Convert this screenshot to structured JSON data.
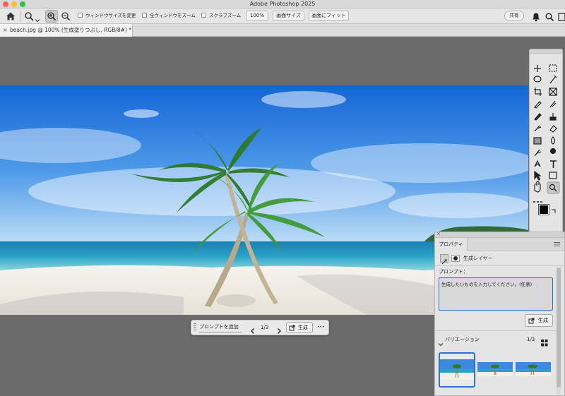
{
  "window": {
    "title": "Adobe Photoshop 2025"
  },
  "options_bar": {
    "resize_window_label": "ウィンドウサイズを変更",
    "zoom_all_windows_label": "全ウィンドウをズーム",
    "scrubby_zoom_label": "スクラブズーム",
    "zoom_value": "100%",
    "fit_screen_label": "画面サイズ",
    "fill_screen_label": "画面にフィット",
    "share_label": "共有"
  },
  "document_tab": {
    "title": "beach.jpg @ 100% (生成塗りつぶし, RGB/8#) *",
    "close_glyph": "×"
  },
  "contextual_taskbar": {
    "prompt_label": "プロンプトを追加",
    "page_indicator": "1/3",
    "generate_label": "生成",
    "more_glyph": "•••"
  },
  "properties_panel": {
    "tab_label": "プロパティ",
    "layer_type": "生成レイヤー",
    "prompt_heading": "プロンプト：",
    "prompt_placeholder": "生成したいものを入力してください。(任意)",
    "generate_label": "生成",
    "variations_heading": "バリエーション",
    "variation_count": "1/3"
  },
  "colors": {
    "accent": "#2f6fd6",
    "foreground": "#000000",
    "background": "#9fd3ef"
  },
  "icons": {
    "home": "home-icon",
    "zoom": "zoom-icon",
    "zoom_in": "zoom-in-icon",
    "zoom_out": "zoom-out-icon",
    "bell": "bell-icon",
    "search": "search-icon",
    "workspace": "workspace-icon"
  }
}
